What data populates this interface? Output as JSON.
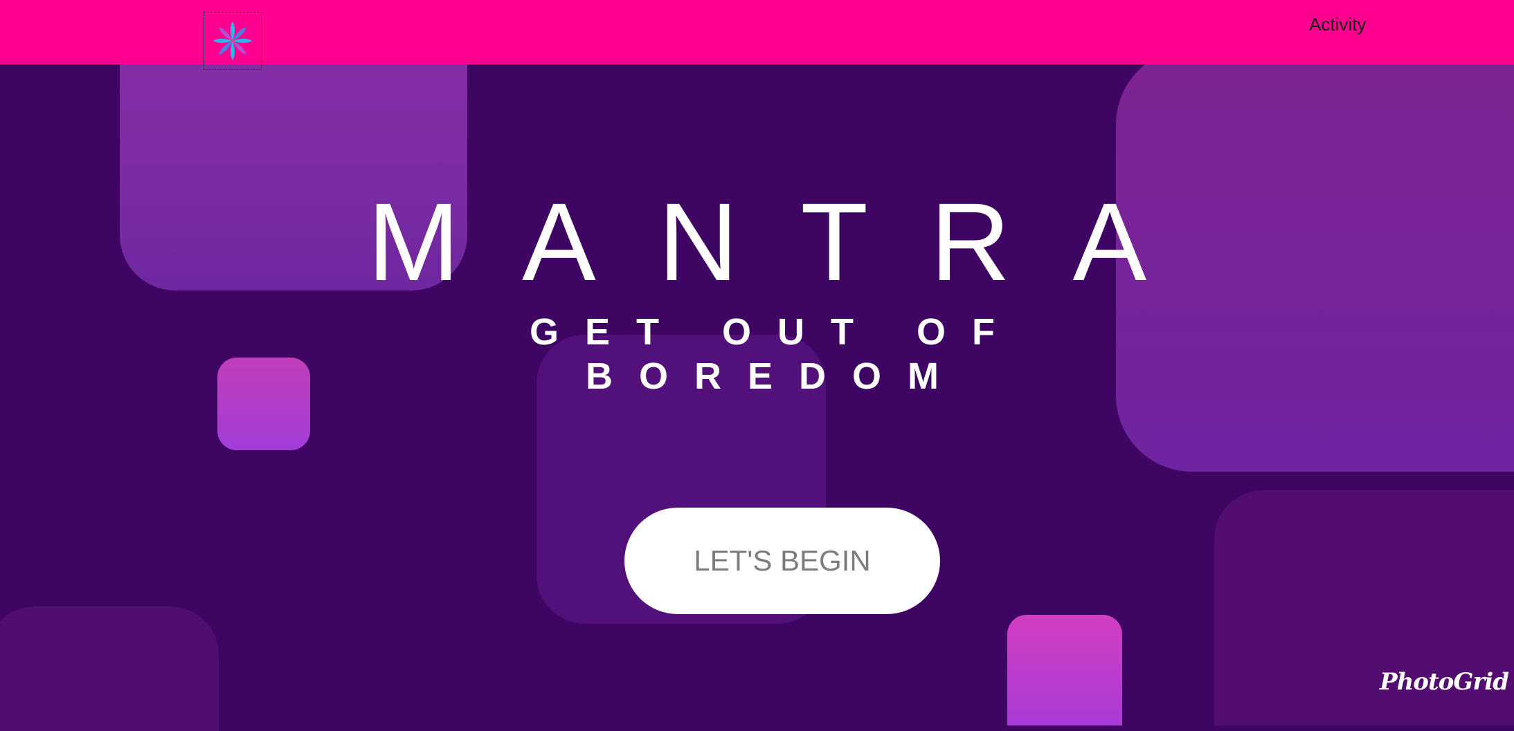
{
  "navbar": {
    "logo_icon": "lotus-flower-icon",
    "links": [
      {
        "label": "Activity"
      }
    ],
    "background": "#ff0090"
  },
  "hero": {
    "title": "MANTRA",
    "tagline": "GET OUT OF BOREDOM",
    "cta_label": "LET'S BEGIN",
    "background": "#3f0562"
  },
  "watermark": "PhotoGrid"
}
